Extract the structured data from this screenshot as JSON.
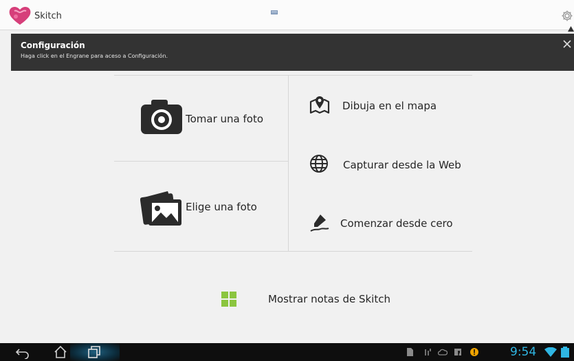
{
  "app": {
    "title": "Skitch"
  },
  "banner": {
    "title": "Configuración",
    "text": "Haga click en el Engrane para aceso a Configuración."
  },
  "options": {
    "take_photo": "Tomar una foto",
    "choose_photo": "Elige una foto",
    "draw_map": "Dibuja en el mapa",
    "capture_web": "Capturar desde la Web",
    "start_scratch": "Comenzar desde cero",
    "show_notes": "Mostrar notas de Skitch"
  },
  "status": {
    "time": "9:54"
  },
  "colors": {
    "accent_green": "#8bc53f",
    "clock_blue": "#2fb6e3",
    "banner_bg": "#333333",
    "logo_pink": "#d63f7a"
  },
  "icons": {
    "logo": "skitch-heart-logo",
    "settings": "gear-icon",
    "close": "close-icon",
    "camera": "camera-icon",
    "photos": "photos-icon",
    "map": "map-pin-icon",
    "web": "globe-icon",
    "pen": "pen-icon",
    "grid": "grid-icon",
    "back": "back-icon",
    "home": "home-icon",
    "recents": "recent-apps-icon"
  }
}
